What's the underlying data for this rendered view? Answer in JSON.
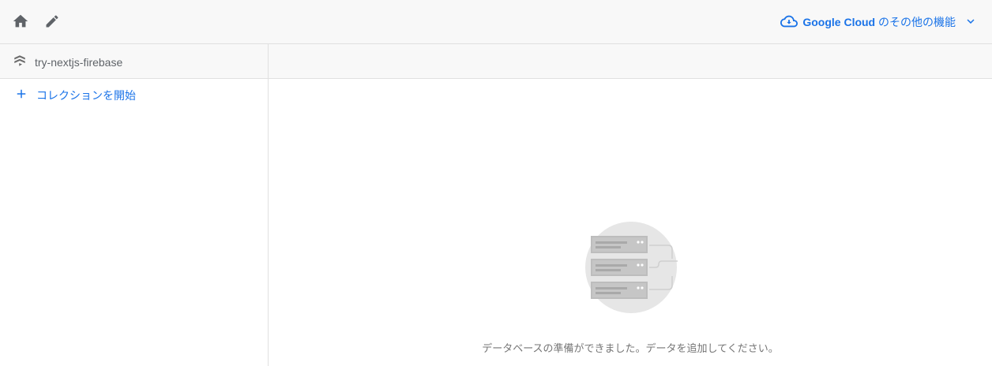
{
  "toolbar": {
    "home_icon": "home-icon",
    "edit_icon": "pencil-icon",
    "google_cloud_link": {
      "icon": "cloud-icon",
      "brand": "Google Cloud",
      "suffix": " のその他の機能",
      "chevron": "chevron-down-icon"
    }
  },
  "database": {
    "icon": "firestore-icon",
    "name": "try-nextjs-firebase"
  },
  "left_panel": {
    "start_collection": {
      "icon": "plus-icon",
      "label": "コレクションを開始"
    }
  },
  "empty_state": {
    "illustration": "database-servers-illustration",
    "message": "データベースの準備ができました。データを追加してください。"
  },
  "colors": {
    "accent": "#1a73e8",
    "toolbar_bg": "#f8f8f8",
    "border": "#e0e0e0",
    "text_secondary": "#5f6368"
  }
}
